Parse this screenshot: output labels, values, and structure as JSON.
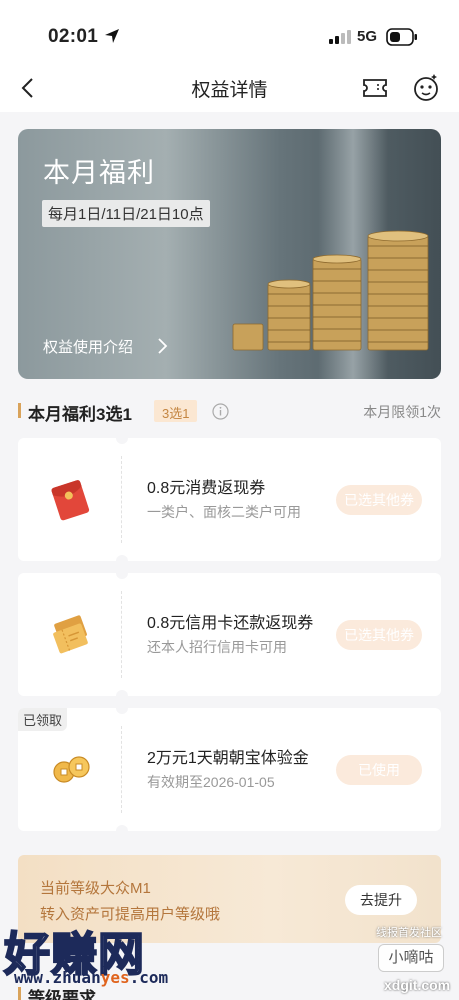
{
  "status_bar": {
    "time": "02:01",
    "network": "5G"
  },
  "nav": {
    "title": "权益详情"
  },
  "banner": {
    "title": "本月福利",
    "date_note": "每月1日/11日/21日10点",
    "link_label": "权益使用介绍"
  },
  "section": {
    "title": "本月福利3选1",
    "badge": "3选1",
    "limit_note": "本月限领1次"
  },
  "offers": [
    {
      "title": "0.8元消费返现券",
      "subtitle": "一类户、面核二类户可用",
      "button": "已选其他券",
      "tag": ""
    },
    {
      "title": "0.8元信用卡还款返现券",
      "subtitle": "还本人招行信用卡可用",
      "button": "已选其他券",
      "tag": ""
    },
    {
      "title": "2万元1天朝朝宝体验金",
      "subtitle": "有效期至2026-01-05",
      "button": "已使用",
      "tag": "已领取"
    }
  ],
  "level_card": {
    "title": "当前等级大众M1",
    "subtitle": "转入资产可提高用户等级哦",
    "button": "去提升"
  },
  "bottom_section": {
    "title": "等级要求"
  },
  "watermark": {
    "main": "好赚网",
    "url_prefix": "www.zhuan",
    "url_accent": "yes",
    "url_suffix": ".com",
    "right_top": "线报首发社区",
    "right_logo": "小嘀咕",
    "right_url": "xdgit.com"
  },
  "colors": {
    "accent": "#d9a35b",
    "badge_bg": "#fbe7d2",
    "disabled_button": "#fbeadc",
    "level_text": "#b4763c"
  }
}
